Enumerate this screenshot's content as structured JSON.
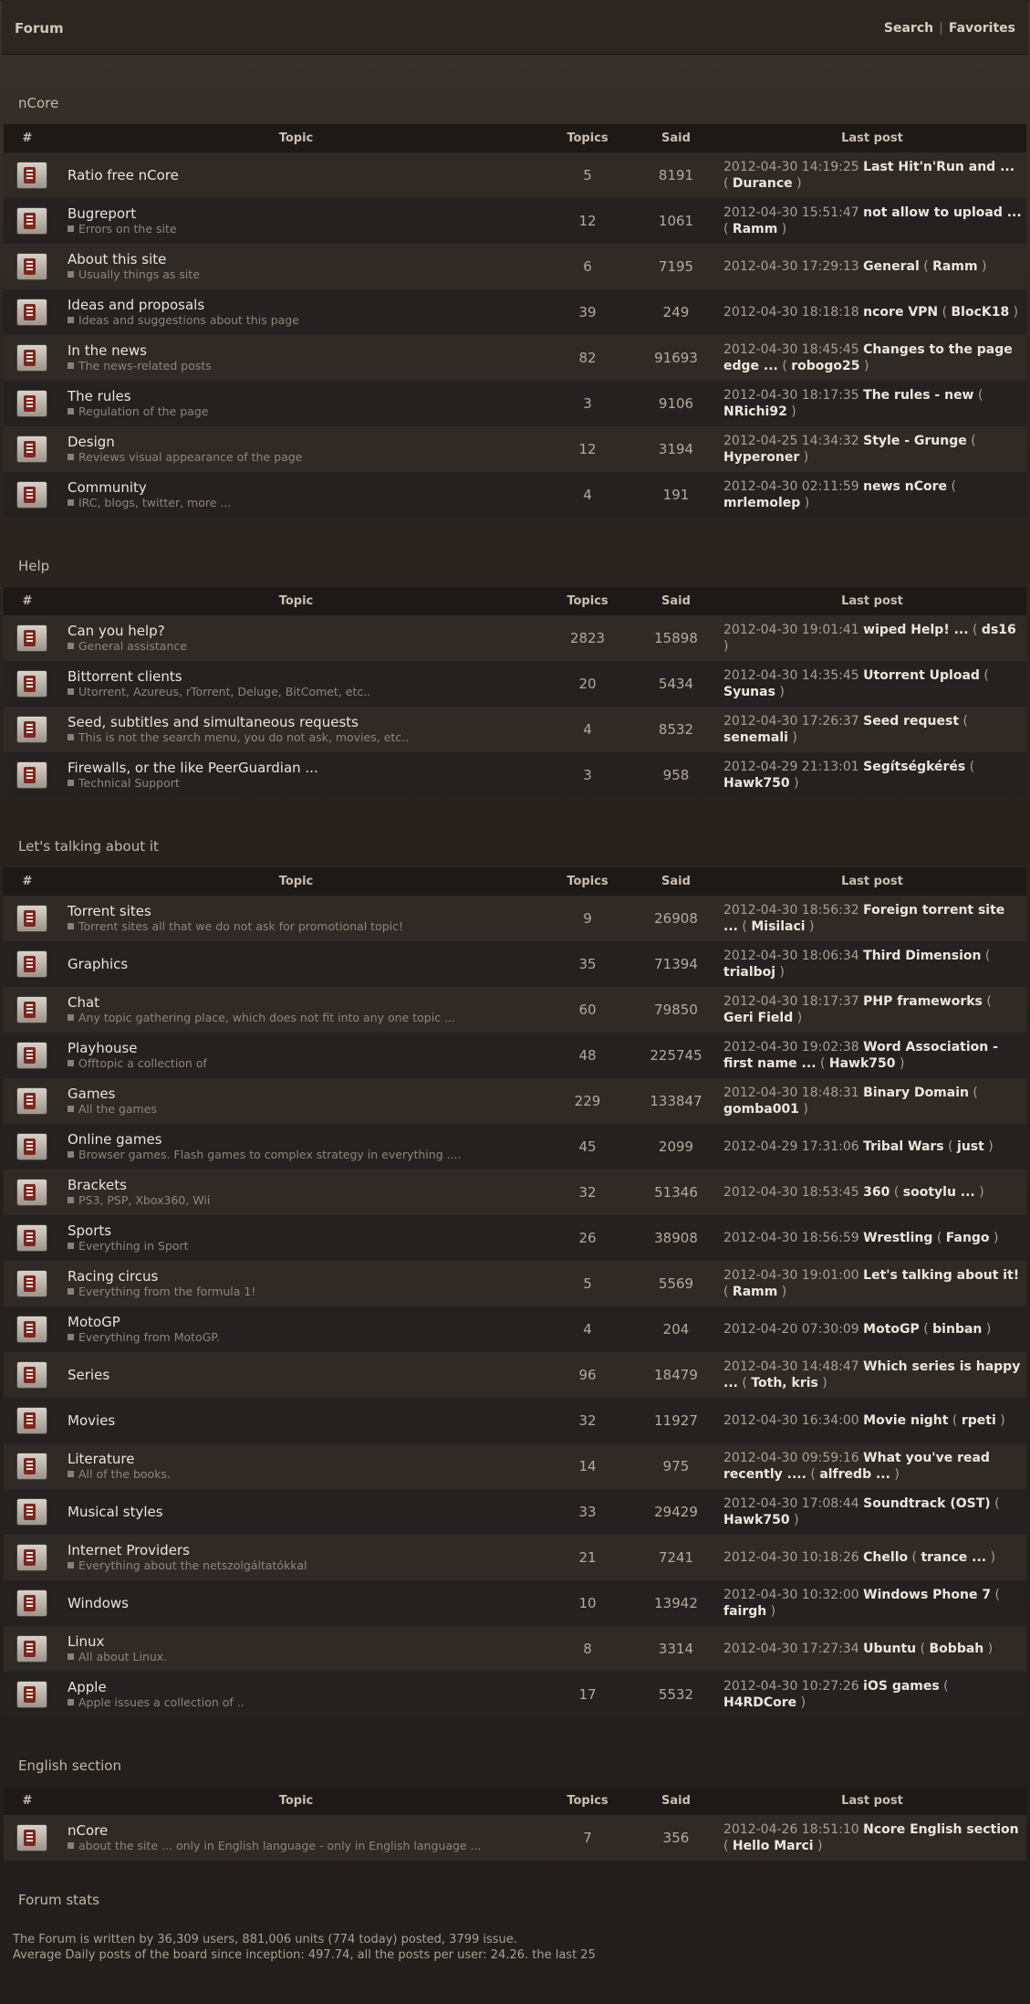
{
  "header": {
    "title": "Forum",
    "links": [
      "Search",
      "Favorites"
    ],
    "separator": "|"
  },
  "columns": {
    "num": "#",
    "topic": "Topic",
    "topics": "Topics",
    "said": "Said",
    "last": "Last post"
  },
  "sections": [
    {
      "title": "nCore",
      "forums": [
        {
          "name": "Ratio free nCore",
          "desc": "",
          "topics": "5",
          "said": "8191",
          "date": "2012-04-30 14:19:25",
          "post": "Last Hit'n'Run and ...",
          "user": "Durance"
        },
        {
          "name": "Bugreport",
          "desc": "Errors on the site",
          "topics": "12",
          "said": "1061",
          "date": "2012-04-30 15:51:47",
          "post": "not allow to upload ...",
          "user": "Ramm"
        },
        {
          "name": "About this site",
          "desc": "Usually things as site",
          "topics": "6",
          "said": "7195",
          "date": "2012-04-30 17:29:13",
          "post": "General",
          "user": "Ramm"
        },
        {
          "name": "Ideas and proposals",
          "desc": "Ideas and suggestions about this page",
          "topics": "39",
          "said": "249",
          "date": "2012-04-30 18:18:18",
          "post": "ncore VPN",
          "user": "BlocK18"
        },
        {
          "name": "In the news",
          "desc": "The news-related posts",
          "topics": "82",
          "said": "91693",
          "date": "2012-04-30 18:45:45",
          "post": "Changes to the page edge ...",
          "user": "robogo25"
        },
        {
          "name": "The rules",
          "desc": "Regulation of the page",
          "topics": "3",
          "said": "9106",
          "date": "2012-04-30 18:17:35",
          "post": "The rules - new",
          "user": "NRichi92"
        },
        {
          "name": "Design",
          "desc": "Reviews visual appearance of the page",
          "topics": "12",
          "said": "3194",
          "date": "2012-04-25 14:34:32",
          "post": "Style - Grunge",
          "user": "Hyperoner"
        },
        {
          "name": "Community",
          "desc": "IRC, blogs, twitter, more ...",
          "topics": "4",
          "said": "191",
          "date": "2012-04-30 02:11:59",
          "post": "news nCore",
          "user": "mrlemolep"
        }
      ]
    },
    {
      "title": "Help",
      "forums": [
        {
          "name": "Can you help?",
          "desc": "General assistance",
          "topics": "2823",
          "said": "15898",
          "date": "2012-04-30 19:01:41",
          "post": "wiped Help! ...",
          "user": "ds16"
        },
        {
          "name": "Bittorrent clients",
          "desc": "Utorrent, Azureus, rTorrent, Deluge, BitComet, etc..",
          "topics": "20",
          "said": "5434",
          "date": "2012-04-30 14:35:45",
          "post": "Utorrent Upload",
          "user": "Syunas"
        },
        {
          "name": "Seed, subtitles and simultaneous requests",
          "desc": "This is not the search menu, you do not ask, movies, etc..",
          "topics": "4",
          "said": "8532",
          "date": "2012-04-30 17:26:37",
          "post": "Seed request",
          "user": "senemali"
        },
        {
          "name": "Firewalls, or the like PeerGuardian ...",
          "desc": "Technical Support",
          "topics": "3",
          "said": "958",
          "date": "2012-04-29 21:13:01",
          "post": "Segítségkérés",
          "user": "Hawk750"
        }
      ]
    },
    {
      "title": "Let's talking about it",
      "forums": [
        {
          "name": "Torrent sites",
          "desc": "Torrent sites all that we do not ask for promotional topic!",
          "topics": "9",
          "said": "26908",
          "date": "2012-04-30 18:56:32",
          "post": "Foreign torrent site ...",
          "user": "Misilaci"
        },
        {
          "name": "Graphics",
          "desc": "",
          "topics": "35",
          "said": "71394",
          "date": "2012-04-30 18:06:34",
          "post": "Third Dimension",
          "user": "trialboj"
        },
        {
          "name": "Chat",
          "desc": "Any topic gathering place, which does not fit into any one topic ...",
          "topics": "60",
          "said": "79850",
          "date": "2012-04-30 18:17:37",
          "post": "PHP frameworks",
          "user": "Geri Field"
        },
        {
          "name": "Playhouse",
          "desc": "Offtopic a collection of",
          "topics": "48",
          "said": "225745",
          "date": "2012-04-30 19:02:38",
          "post": "Word Association - first name ...",
          "user": "Hawk750"
        },
        {
          "name": "Games",
          "desc": "All the games",
          "topics": "229",
          "said": "133847",
          "date": "2012-04-30 18:48:31",
          "post": "Binary Domain",
          "user": "gomba001"
        },
        {
          "name": "Online games",
          "desc": "Browser games. Flash games to complex strategy in everything ....",
          "topics": "45",
          "said": "2099",
          "date": "2012-04-29 17:31:06",
          "post": "Tribal Wars",
          "user": "just"
        },
        {
          "name": "Brackets",
          "desc": "PS3, PSP, Xbox360, Wii",
          "topics": "32",
          "said": "51346",
          "date": "2012-04-30 18:53:45",
          "post": "360",
          "user": "sootylu ..."
        },
        {
          "name": "Sports",
          "desc": "Everything in Sport",
          "topics": "26",
          "said": "38908",
          "date": "2012-04-30 18:56:59",
          "post": "Wrestling",
          "user": "Fango"
        },
        {
          "name": "Racing circus",
          "desc": "Everything from the formula 1!",
          "topics": "5",
          "said": "5569",
          "date": "2012-04-30 19:01:00",
          "post": "Let's talking about it!",
          "user": "Ramm"
        },
        {
          "name": "MotoGP",
          "desc": "Everything from MotoGP.",
          "topics": "4",
          "said": "204",
          "date": "2012-04-20 07:30:09",
          "post": "MotoGP",
          "user": "binban"
        },
        {
          "name": "Series",
          "desc": "",
          "topics": "96",
          "said": "18479",
          "date": "2012-04-30 14:48:47",
          "post": "Which series is happy ...",
          "user": "Toth, kris"
        },
        {
          "name": "Movies",
          "desc": "",
          "topics": "32",
          "said": "11927",
          "date": "2012-04-30 16:34:00",
          "post": "Movie night",
          "user": "rpeti"
        },
        {
          "name": "Literature",
          "desc": "All of the books.",
          "topics": "14",
          "said": "975",
          "date": "2012-04-30 09:59:16",
          "post": "What you've read recently ....",
          "user": "alfredb ..."
        },
        {
          "name": "Musical styles",
          "desc": "",
          "topics": "33",
          "said": "29429",
          "date": "2012-04-30 17:08:44",
          "post": "Soundtrack (OST)",
          "user": "Hawk750"
        },
        {
          "name": "Internet Providers",
          "desc": "Everything about the netszolgáltatókkal",
          "topics": "21",
          "said": "7241",
          "date": "2012-04-30 10:18:26",
          "post": "Chello",
          "user": "trance ..."
        },
        {
          "name": "Windows",
          "desc": "",
          "topics": "10",
          "said": "13942",
          "date": "2012-04-30 10:32:00",
          "post": "Windows Phone 7",
          "user": "fairgh"
        },
        {
          "name": "Linux",
          "desc": "All about Linux.",
          "topics": "8",
          "said": "3314",
          "date": "2012-04-30 17:27:34",
          "post": "Ubuntu",
          "user": "Bobbah"
        },
        {
          "name": "Apple",
          "desc": "Apple issues a collection of ..",
          "topics": "17",
          "said": "5532",
          "date": "2012-04-30 10:27:26",
          "post": "iOS games",
          "user": "H4RDCore"
        }
      ]
    },
    {
      "title": "English section",
      "forums": [
        {
          "name": "nCore",
          "desc": "about the site ... only in English language - only in English language ...",
          "topics": "7",
          "said": "356",
          "date": "2012-04-26 18:51:10",
          "post": "Ncore English section",
          "user": "Hello Marci"
        }
      ]
    }
  ],
  "stats": {
    "title": "Forum stats",
    "line1": "The Forum is written by 36,309 users, 881,006 units (774 today) posted, 3799 issue.",
    "line2": "Average Daily posts of the board since inception: 497.74, all the posts per user: 24.26. the last 25"
  }
}
